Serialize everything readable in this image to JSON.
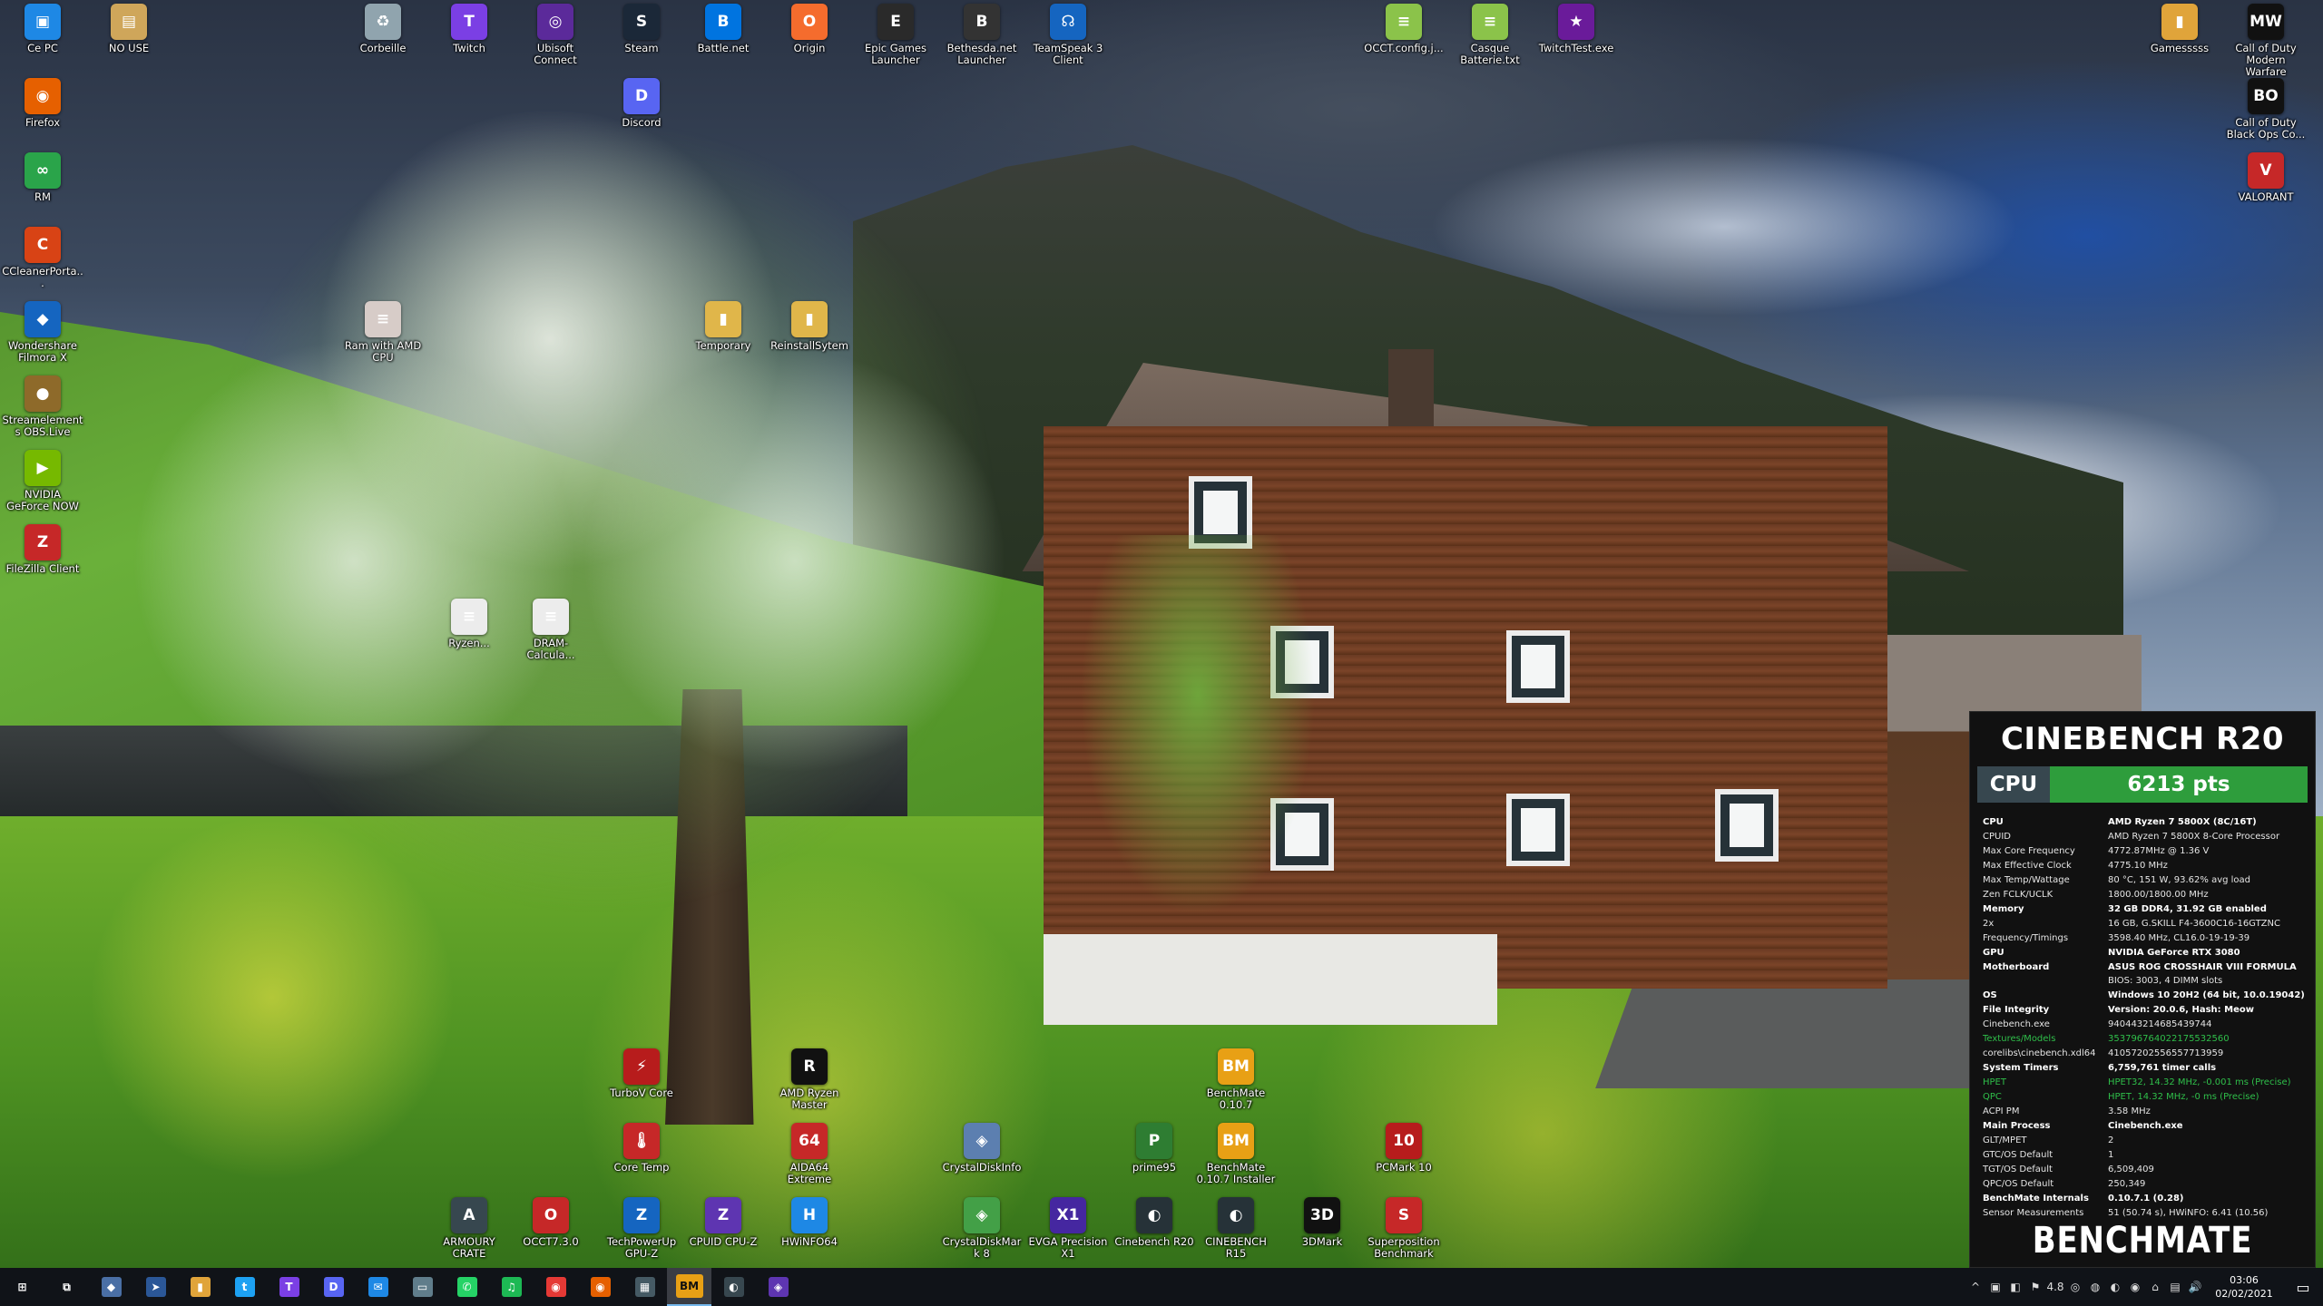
{
  "desktop_icons": [
    {
      "label": "Ce PC",
      "icon": "computer-icon",
      "color": "#1e88e5",
      "glyph": "▣"
    },
    {
      "label": "NO USE",
      "icon": "file-icon",
      "color": "#cfa65a",
      "glyph": "▤"
    },
    {
      "label": "Firefox",
      "icon": "firefox-icon",
      "color": "#e66000",
      "glyph": "◉"
    },
    {
      "label": "RM",
      "icon": "rm-icon",
      "color": "#2aa44a",
      "glyph": "∞"
    },
    {
      "label": "CCleanerPorta...",
      "icon": "ccleaner-icon",
      "color": "#d84315",
      "glyph": "C"
    },
    {
      "label": "Wondershare Filmora X",
      "icon": "filmora-icon",
      "color": "#1565c0",
      "glyph": "◆"
    },
    {
      "label": "Streamelements OBS.Live",
      "icon": "obs-icon",
      "color": "#8e6a2a",
      "glyph": "●"
    },
    {
      "label": "NVIDIA GeForce NOW",
      "icon": "geforce-now-icon",
      "color": "#76b900",
      "glyph": "▶"
    },
    {
      "label": "FileZilla Client",
      "icon": "filezilla-icon",
      "color": "#c62828",
      "glyph": "Z"
    },
    {
      "label": "Corbeille",
      "icon": "recycle-bin-icon",
      "color": "#90a4ae",
      "glyph": "♻"
    },
    {
      "label": "Twitch",
      "icon": "twitch-icon",
      "color": "#7b3fe4",
      "glyph": "T"
    },
    {
      "label": "Ubisoft Connect",
      "icon": "ubisoft-icon",
      "color": "#5b2a9a",
      "glyph": "◎"
    },
    {
      "label": "Steam",
      "icon": "steam-icon",
      "color": "#1b2838",
      "glyph": "S"
    },
    {
      "label": "Battle.net",
      "icon": "battlenet-icon",
      "color": "#0074e0",
      "glyph": "B"
    },
    {
      "label": "Origin",
      "icon": "origin-icon",
      "color": "#f56c2d",
      "glyph": "O"
    },
    {
      "label": "Epic Games Launcher",
      "icon": "epic-games-icon",
      "color": "#2a2a2a",
      "glyph": "E"
    },
    {
      "label": "Bethesda.net Launcher",
      "icon": "bethesda-icon",
      "color": "#333",
      "glyph": "B"
    },
    {
      "label": "TeamSpeak 3 Client",
      "icon": "teamspeak-icon",
      "color": "#1565c0",
      "glyph": "☊"
    },
    {
      "label": "Discord",
      "icon": "discord-icon",
      "color": "#5865f2",
      "glyph": "D"
    },
    {
      "label": "OCCT.config.j...",
      "icon": "text-file-icon",
      "color": "#8bc34a",
      "glyph": "≡"
    },
    {
      "label": "Casque Batterie.txt",
      "icon": "text-file-icon",
      "color": "#8bc34a",
      "glyph": "≡"
    },
    {
      "label": "TwitchTest.exe",
      "icon": "twitchtest-icon",
      "color": "#6a1b9a",
      "glyph": "★"
    },
    {
      "label": "Gamesssss",
      "icon": "folder-icon",
      "color": "#e0a43a",
      "glyph": "▮"
    },
    {
      "label": "Call of Duty Modern Warfare",
      "icon": "cod-mw-icon",
      "color": "#111",
      "glyph": "MW"
    },
    {
      "label": "Call of Duty Black Ops Co...",
      "icon": "cod-bo-icon",
      "color": "#111",
      "glyph": "BO"
    },
    {
      "label": "VALORANT",
      "icon": "valorant-icon",
      "color": "#c62828",
      "glyph": "V"
    },
    {
      "label": "Ram with AMD CPU",
      "icon": "text-file-icon",
      "color": "#d7ccc8",
      "glyph": "≡"
    },
    {
      "label": "Temporary",
      "icon": "folder-icon",
      "color": "#e0b64a",
      "glyph": "▮"
    },
    {
      "label": "ReinstallSytem",
      "icon": "folder-icon",
      "color": "#e0b64a",
      "glyph": "▮"
    },
    {
      "label": "Ryzen...",
      "icon": "text-file-icon",
      "color": "#ececec",
      "glyph": "≡"
    },
    {
      "label": "DRAM-Calcula...",
      "icon": "text-file-icon",
      "color": "#ececec",
      "glyph": "≡"
    },
    {
      "label": "TurboV Core",
      "icon": "turbov-icon",
      "color": "#b71c1c",
      "glyph": "⚡"
    },
    {
      "label": "AMD Ryzen Master",
      "icon": "ryzen-master-icon",
      "color": "#111",
      "glyph": "R"
    },
    {
      "label": "BenchMate 0.10.7",
      "icon": "benchmate-icon",
      "color": "#e8a015",
      "glyph": "BM"
    },
    {
      "label": "Core Temp",
      "icon": "core-temp-icon",
      "color": "#c62828",
      "glyph": "🌡"
    },
    {
      "label": "AIDA64 Extreme",
      "icon": "aida64-icon",
      "color": "#c62828",
      "glyph": "64"
    },
    {
      "label": "CrystalDiskInfo",
      "icon": "crystaldiskinfo-icon",
      "color": "#5c7fb0",
      "glyph": "◈"
    },
    {
      "label": "prime95",
      "icon": "prime95-icon",
      "color": "#2e7d32",
      "glyph": "P"
    },
    {
      "label": "BenchMate 0.10.7 Installer",
      "icon": "benchmate-installer-icon",
      "color": "#e8a015",
      "glyph": "BM"
    },
    {
      "label": "PCMark 10",
      "icon": "pcmark-icon",
      "color": "#b71c1c",
      "glyph": "10"
    },
    {
      "label": "ARMOURY CRATE",
      "icon": "armoury-crate-icon",
      "color": "#37474f",
      "glyph": "A"
    },
    {
      "label": "OCCT7.3.0",
      "icon": "occt-icon",
      "color": "#c62828",
      "glyph": "O"
    },
    {
      "label": "TechPowerUp GPU-Z",
      "icon": "gpuz-icon",
      "color": "#1565c0",
      "glyph": "Z"
    },
    {
      "label": "CPUID CPU-Z",
      "icon": "cpuz-icon",
      "color": "#5e35b1",
      "glyph": "Z"
    },
    {
      "label": "HWiNFO64",
      "icon": "hwinfo-icon",
      "color": "#1e88e5",
      "glyph": "H"
    },
    {
      "label": "CrystalDiskMark 8",
      "icon": "crystaldiskmark-icon",
      "color": "#43a047",
      "glyph": "◈"
    },
    {
      "label": "EVGA Precision X1",
      "icon": "evga-icon",
      "color": "#4527a0",
      "glyph": "X1"
    },
    {
      "label": "Cinebench R20",
      "icon": "cinebench-icon",
      "color": "#263238",
      "glyph": "◐"
    },
    {
      "label": "CINEBENCH R15",
      "icon": "cinebench-r15-icon",
      "color": "#263238",
      "glyph": "◐"
    },
    {
      "label": "3DMark",
      "icon": "3dmark-icon",
      "color": "#111",
      "glyph": "3D"
    },
    {
      "label": "Superposition Benchmark",
      "icon": "superposition-icon",
      "color": "#c62828",
      "glyph": "S"
    }
  ],
  "benchmate": {
    "title": "CINEBENCH R20",
    "score_label": "CPU",
    "score_value": "6213 pts",
    "logo": "BENCHMATE",
    "rows": [
      {
        "k": "CPU",
        "v": "AMD Ryzen 7 5800X (8C/16T)",
        "style": "sec"
      },
      {
        "k": "CPUID",
        "v": "AMD Ryzen 7 5800X 8-Core Processor",
        "style": ""
      },
      {
        "k": "Max Core Frequency",
        "v": "4772.87MHz @ 1.36 V",
        "style": ""
      },
      {
        "k": "Max Effective Clock",
        "v": "4775.10 MHz",
        "style": ""
      },
      {
        "k": "Max Temp/Wattage",
        "v": "80 °C, 151 W, 93.62% avg load",
        "style": ""
      },
      {
        "k": "Zen FCLK/UCLK",
        "v": "1800.00/1800.00 MHz",
        "style": ""
      },
      {
        "k": "Memory",
        "v": "32 GB DDR4, 31.92 GB enabled",
        "style": "sec"
      },
      {
        "k": "2x",
        "v": "16 GB, G.SKILL F4-3600C16-16GTZNC",
        "style": ""
      },
      {
        "k": "Frequency/Timings",
        "v": "3598.40 MHz, CL16.0-19-19-39",
        "style": ""
      },
      {
        "k": "GPU",
        "v": "NVIDIA GeForce RTX 3080",
        "style": "sec"
      },
      {
        "k": "Motherboard",
        "v": "ASUS ROG CROSSHAIR VIII FORMULA",
        "style": "sec"
      },
      {
        "k": "",
        "v": "BIOS: 3003, 4 DIMM slots",
        "style": ""
      },
      {
        "k": "OS",
        "v": "Windows 10 20H2 (64 bit, 10.0.19042)",
        "style": "sec"
      },
      {
        "k": "File Integrity",
        "v": "Version: 20.0.6, Hash: Meow",
        "style": "sec"
      },
      {
        "k": "Cinebench.exe",
        "v": "9404432146854397​44",
        "style": ""
      },
      {
        "k": "Textures/Models",
        "v": "3537967640221755​32560",
        "style": "green"
      },
      {
        "k": "corelibs\\cinebench.xdl64",
        "v": "4105720255655771​3959",
        "style": ""
      },
      {
        "k": "System Timers",
        "v": "6,759,761 timer calls",
        "style": "sec"
      },
      {
        "k": "HPET",
        "v": "HPET32, 14.32 MHz, -0.001 ms (Precise)",
        "style": "green"
      },
      {
        "k": "QPC",
        "v": "HPET, 14.32 MHz, -0 ms (Precise)",
        "style": "green"
      },
      {
        "k": "ACPI PM",
        "v": "3.58 MHz",
        "style": ""
      },
      {
        "k": "Main Process",
        "v": "Cinebench.exe",
        "style": "sec"
      },
      {
        "k": "GLT/MPET",
        "v": "2",
        "style": ""
      },
      {
        "k": "GTC/OS Default",
        "v": "1",
        "style": ""
      },
      {
        "k": "TGT/OS Default",
        "v": "6,509,409",
        "style": ""
      },
      {
        "k": "QPC/OS Default",
        "v": "250,349",
        "style": ""
      },
      {
        "k": "BenchMate Internals",
        "v": "0.10.7.1 (0.28)",
        "style": "sec"
      },
      {
        "k": "Sensor Measurements",
        "v": "51 (50.74 s), HWiNFO: 6.41 (10.56)",
        "style": ""
      }
    ]
  },
  "taskbar": {
    "items": [
      {
        "name": "start-button",
        "icon": "windows-icon",
        "glyph": "⊞",
        "color": "#ffffff",
        "bg": "transparent"
      },
      {
        "name": "task-view-button",
        "icon": "task-view-icon",
        "glyph": "⧉",
        "color": "#ffffff",
        "bg": "transparent"
      },
      {
        "name": "taskbar-app-1",
        "icon": "app-icon",
        "glyph": "◆",
        "color": "#ffffff",
        "bg": "#4a6fa5"
      },
      {
        "name": "taskbar-app-2",
        "icon": "app-icon",
        "glyph": "➤",
        "color": "#ffffff",
        "bg": "#2b5797"
      },
      {
        "name": "taskbar-explorer",
        "icon": "folder-icon",
        "glyph": "▮",
        "color": "#ffffff",
        "bg": "#e0a43a"
      },
      {
        "name": "taskbar-twitter",
        "icon": "twitter-icon",
        "glyph": "t",
        "color": "#ffffff",
        "bg": "#1da1f2"
      },
      {
        "name": "taskbar-twitch",
        "icon": "twitch-icon",
        "glyph": "T",
        "color": "#ffffff",
        "bg": "#7b3fe4"
      },
      {
        "name": "taskbar-discord",
        "icon": "discord-icon",
        "glyph": "D",
        "color": "#ffffff",
        "bg": "#5865f2"
      },
      {
        "name": "taskbar-mail",
        "icon": "mail-icon",
        "glyph": "✉",
        "color": "#ffffff",
        "bg": "#1e88e5"
      },
      {
        "name": "taskbar-app-3",
        "icon": "app-icon",
        "glyph": "▭",
        "color": "#ffffff",
        "bg": "#607d8b"
      },
      {
        "name": "taskbar-whatsapp",
        "icon": "whatsapp-icon",
        "glyph": "✆",
        "color": "#ffffff",
        "bg": "#25d366"
      },
      {
        "name": "taskbar-spotify",
        "icon": "spotify-icon",
        "glyph": "♫",
        "color": "#ffffff",
        "bg": "#1db954"
      },
      {
        "name": "taskbar-app-4",
        "icon": "app-icon",
        "glyph": "◉",
        "color": "#ffffff",
        "bg": "#e53935"
      },
      {
        "name": "taskbar-firefox",
        "icon": "firefox-icon",
        "glyph": "◉",
        "color": "#ffffff",
        "bg": "#e66000"
      },
      {
        "name": "taskbar-app-5",
        "icon": "app-icon",
        "glyph": "▦",
        "color": "#ffffff",
        "bg": "#455a64"
      },
      {
        "name": "taskbar-benchmate",
        "icon": "benchmate-icon",
        "glyph": "BM",
        "color": "#111111",
        "bg": "#e8a015"
      },
      {
        "name": "taskbar-app-6",
        "icon": "app-icon",
        "glyph": "◐",
        "color": "#ffffff",
        "bg": "#37474f"
      },
      {
        "name": "taskbar-app-7",
        "icon": "app-icon",
        "glyph": "◈",
        "color": "#ffffff",
        "bg": "#5e35b1"
      }
    ],
    "tray_icons": [
      "^",
      "▣",
      "◧",
      "⚑",
      "4.8",
      "◎",
      "◍",
      "◐",
      "◉",
      "⌂",
      "▤",
      "🔊"
    ],
    "clock_time": "03:06",
    "clock_date": "02/02/2021",
    "notification_glyph": "▭"
  }
}
